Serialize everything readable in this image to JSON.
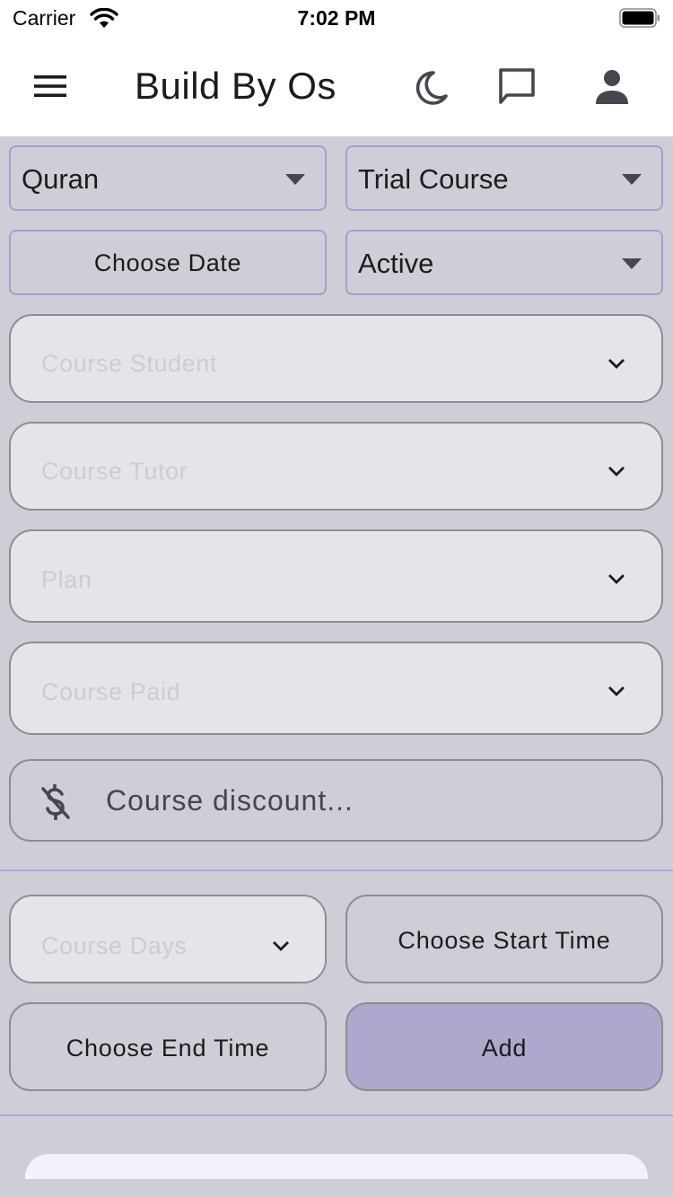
{
  "status_bar": {
    "carrier": "Carrier",
    "time": "7:02 PM",
    "icons": [
      "wifi-icon",
      "battery-icon"
    ]
  },
  "app_bar": {
    "title": "Build By Os",
    "icons": [
      "menu-icon",
      "moon-icon",
      "chat-icon",
      "person-icon"
    ]
  },
  "form": {
    "subject_select": {
      "value": "Quran"
    },
    "course_type_select": {
      "value": "Trial Course"
    },
    "date_button": {
      "label": "Choose Date"
    },
    "status_select": {
      "value": "Active"
    },
    "course_student": {
      "placeholder": "Course Student"
    },
    "course_tutor": {
      "placeholder": "Course Tutor"
    },
    "plan": {
      "placeholder": "Plan"
    },
    "course_paid": {
      "placeholder": "Course Paid"
    },
    "course_discount": {
      "placeholder": "Course discount..."
    },
    "course_days": {
      "placeholder": "Course Days"
    },
    "start_time_button": {
      "label": "Choose Start Time"
    },
    "end_time_button": {
      "label": "Choose End Time"
    },
    "add_button": {
      "label": "Add"
    }
  },
  "colors": {
    "background": "#cfced6",
    "accent_border": "#a19fd4",
    "primary_button": "#aca9cc",
    "field_fill": "#e5e5e9",
    "placeholder": "#cdccd2"
  }
}
